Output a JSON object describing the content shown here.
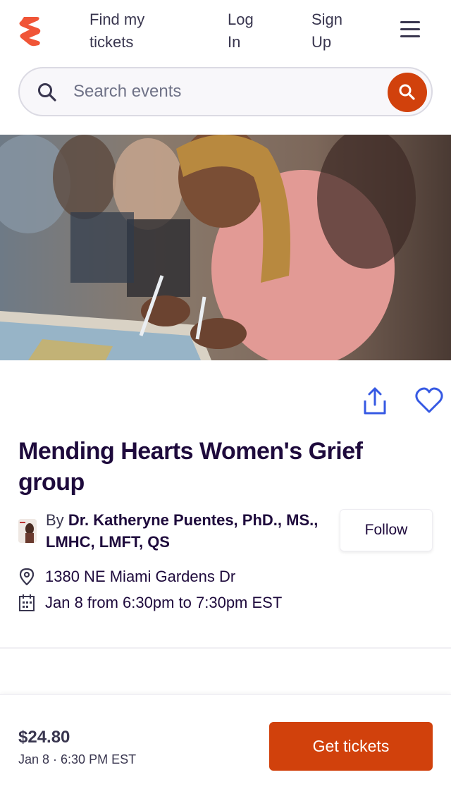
{
  "header": {
    "logo_icon": "eventbrite-logo-icon",
    "nav": {
      "find_tickets": "Find my tickets",
      "login": "Log In",
      "signup": "Sign Up"
    },
    "menu_icon": "hamburger-menu-icon"
  },
  "search": {
    "placeholder": "Search events",
    "icon": "search-icon",
    "submit_icon": "search-icon"
  },
  "event": {
    "title": "Mending Hearts Women's Grief group",
    "organizer_prefix": "By",
    "organizer_name": "Dr. Katheryne Puentes, PhD., MS., LMHC, LMFT, QS",
    "follow_label": "Follow",
    "location": "1380 NE Miami Gardens Dr",
    "date_time": "Jan 8 from 6:30pm to 7:30pm EST",
    "actions": {
      "share_icon": "share-icon",
      "like_icon": "heart-icon"
    }
  },
  "checkout": {
    "price": "$24.80",
    "date": "Jan 8 · 6:30 PM EST",
    "button_label": "Get tickets"
  },
  "colors": {
    "brand": "#d1410c",
    "title": "#1e0a3c",
    "link_blue": "#3659e3",
    "text": "#39364f"
  }
}
